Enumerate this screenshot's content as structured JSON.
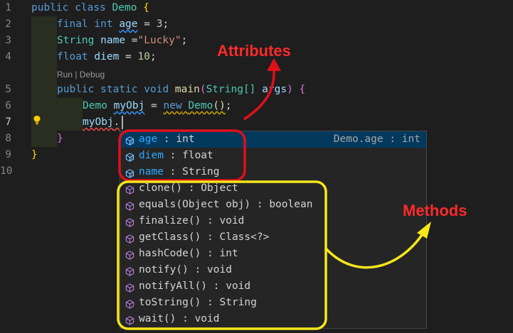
{
  "editor": {
    "line_numbers": [
      "1",
      "2",
      "3",
      "4",
      "5",
      "6",
      "7",
      "8",
      "9",
      "10"
    ],
    "codelens": "Run | Debug",
    "lines": {
      "l1": {
        "public": "public",
        "class": "class",
        "name": "Demo",
        "brace": "{"
      },
      "l2": {
        "final": "final",
        "int": "int",
        "var": "age",
        "eq": " = ",
        "val": "3",
        "semi": ";"
      },
      "l3": {
        "type": "String",
        "var": "name",
        "eq": " =",
        "val": "\"Lucky\"",
        "semi": ";"
      },
      "l4": {
        "type": "float",
        "var": "diem",
        "eq": " = ",
        "val": "10",
        "semi": ";"
      },
      "l5": {
        "public": "public",
        "static": "static",
        "void": "void",
        "fn": "main",
        "open": "(",
        "ptype": "String[]",
        "param": "args",
        "close": ")",
        "brace": "{"
      },
      "l6": {
        "type": "Demo",
        "var": "myObj",
        "eq": " = ",
        "new": "new",
        "ctor": "Demo",
        "paren": "()",
        "semi": ";"
      },
      "l7": {
        "var": "myObj",
        "dot": "."
      },
      "l8": {
        "brace": "}"
      },
      "l9": {
        "brace": "}"
      }
    }
  },
  "suggest": {
    "items": [
      {
        "match": "age",
        "rest": " : int",
        "detail": "Demo.age : int",
        "kind": "field-icon"
      },
      {
        "match": "diem",
        "rest": " : float",
        "kind": "field-icon"
      },
      {
        "match": "name",
        "rest": " : String",
        "kind": "field-icon"
      },
      {
        "label": "clone() : Object",
        "kind": "method-icon"
      },
      {
        "label": "equals(Object obj) : boolean",
        "kind": "method-icon"
      },
      {
        "label": "finalize() : void",
        "kind": "method-icon"
      },
      {
        "label": "getClass() : Class<?>",
        "kind": "method-icon"
      },
      {
        "label": "hashCode() : int",
        "kind": "method-icon"
      },
      {
        "label": "notify() : void",
        "kind": "method-icon"
      },
      {
        "label": "notifyAll() : void",
        "kind": "method-icon"
      },
      {
        "label": "toString() : String",
        "kind": "method-icon"
      },
      {
        "label": "wait() : void",
        "kind": "method-icon"
      }
    ]
  },
  "annotations": {
    "attributes": {
      "text": "Attributes",
      "color": "#ff2a2a"
    },
    "methods": {
      "text": "Methods",
      "color": "#ff2a2a"
    }
  },
  "colors": {
    "attributes_box": "#e0101a",
    "methods_box": "#f5e61b",
    "field_icon": "#75beff",
    "method_icon": "#b180d7",
    "lightbulb": "#ffcc00"
  }
}
